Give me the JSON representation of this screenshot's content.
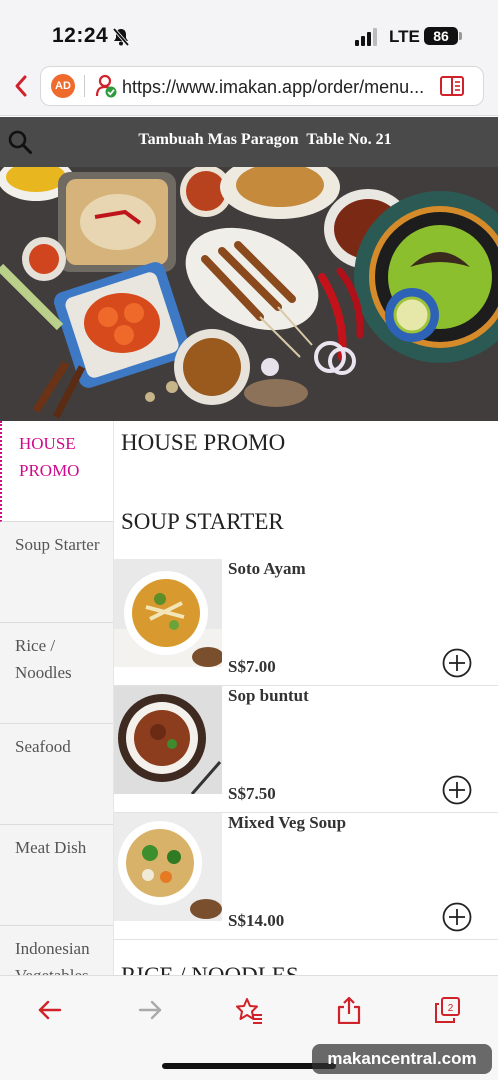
{
  "status_bar": {
    "time": "12:24",
    "network": "LTE",
    "battery": "86",
    "icons": [
      "bell-slash-icon",
      "signal-icon"
    ]
  },
  "browser": {
    "url": "https://www.imakan.app/order/menu...",
    "ad_badge": "AD",
    "icons": [
      "back-chevron-icon",
      "secure-lock-icon",
      "reader-mode-icon"
    ]
  },
  "header": {
    "title": "Tambuah Mas Paragon  Table No. 21",
    "icon": "search-icon"
  },
  "sidebar": {
    "items": [
      {
        "label": "HOUSE PROMO",
        "active": true
      },
      {
        "label": "Soup Starter",
        "active": false
      },
      {
        "label": "Rice / Noodles",
        "active": false
      },
      {
        "label": "Seafood",
        "active": false
      },
      {
        "label": "Meat Dish",
        "active": false
      },
      {
        "label": "Indonesian Vegetables",
        "active": false
      }
    ],
    "active_color": "#cf0a8c"
  },
  "content": {
    "sections": [
      {
        "title": "HOUSE PROMO"
      },
      {
        "title": "SOUP STARTER"
      },
      {
        "title": "RICE / NOODLES"
      }
    ],
    "items": [
      {
        "name": "Soto Ayam",
        "price": "S$7.00"
      },
      {
        "name": "Sop buntut",
        "price": "S$7.50"
      },
      {
        "name": "Mixed Veg Soup",
        "price": "S$14.00"
      }
    ]
  },
  "toolbar": {
    "icons": [
      "back-arrow-icon",
      "forward-arrow-icon",
      "bookmark-star-icon",
      "share-icon",
      "tabs-icon"
    ],
    "tab_count": "2",
    "accent": "#d0222a"
  },
  "watermark": "makancentral.com"
}
